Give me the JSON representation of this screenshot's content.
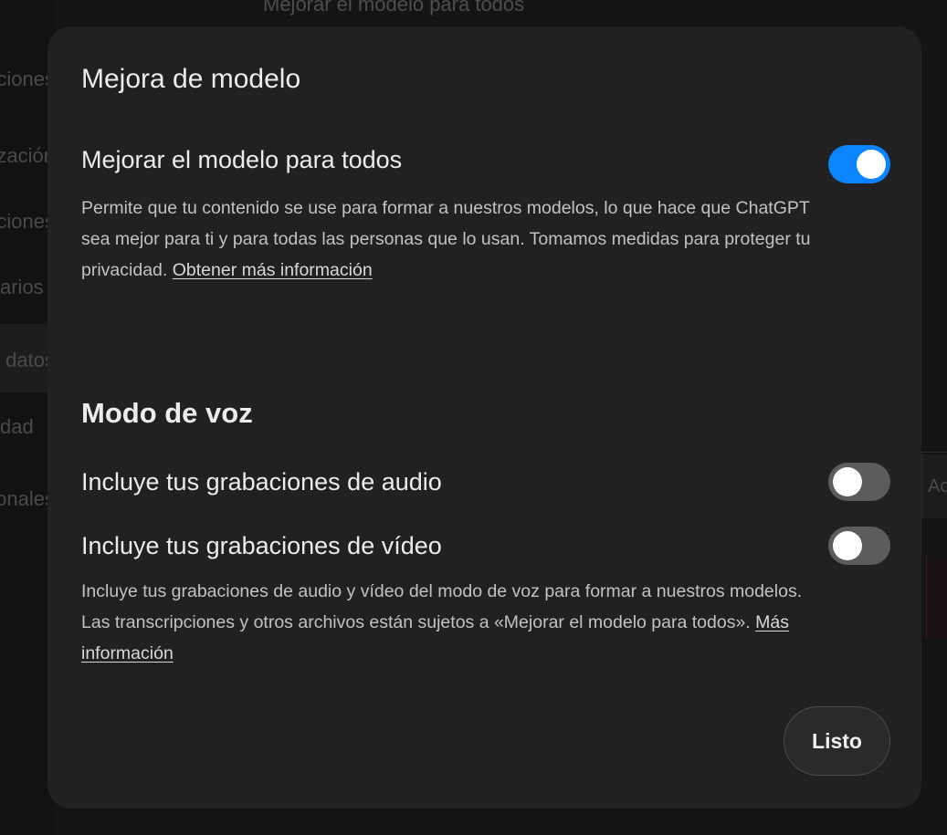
{
  "background": {
    "top_title": "Mejorar el modelo para todos",
    "sidebar_fragments": [
      "ciones",
      "lización",
      "aciones",
      "arios",
      "Controles de datos",
      "dad",
      "Apps personales"
    ],
    "right_fragment": "Ac"
  },
  "modal": {
    "title": "Mejora de modelo",
    "improve": {
      "label": "Mejorar el modelo para todos",
      "enabled": true,
      "description": "Permite que tu contenido se use para formar a nuestros modelos, lo que hace que ChatGPT sea mejor para ti y para todas las personas que lo usan. Tomamos medidas para proteger tu privacidad.",
      "link": "Obtener más información"
    },
    "voice": {
      "section_title": "Modo de voz",
      "audio_label": "Incluye tus grabaciones de audio",
      "audio_enabled": false,
      "video_label": "Incluye tus grabaciones de vídeo",
      "video_enabled": false,
      "description": "Incluye tus grabaciones de audio y vídeo del modo de voz para formar a nuestros modelos. Las transcripciones y otros archivos están sujetos a «Mejorar el modelo para todos».",
      "link": "Más información"
    },
    "done_label": "Listo"
  },
  "colors": {
    "toggle_on": "#0a84ff",
    "toggle_off": "#5c5c5c",
    "modal_bg": "#212121"
  }
}
